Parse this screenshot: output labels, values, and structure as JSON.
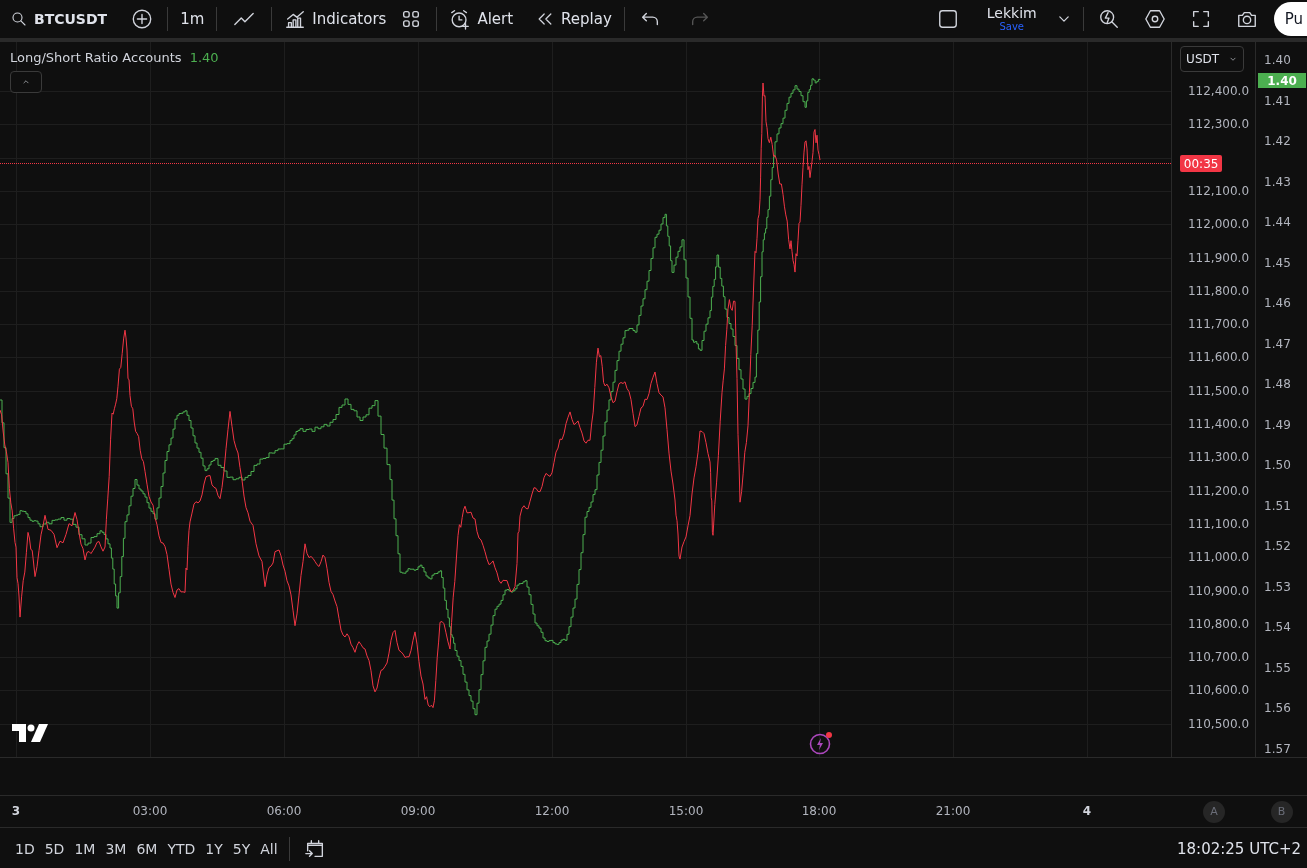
{
  "toolbar": {
    "symbol": "BTCUSDT",
    "interval": "1m",
    "indicators": "Indicators",
    "alert": "Alert",
    "replay": "Replay",
    "layout_name": "Lekkim",
    "save": "Save",
    "publish": "Pu"
  },
  "legend": {
    "title": "Long/Short Ratio Accounts",
    "value": "1.40"
  },
  "currency": "USDT",
  "price_axis": [
    "112,400.0",
    "112,300.0",
    "112,100.0",
    "112,000.0",
    "111,900.0",
    "111,800.0",
    "111,700.0",
    "111,600.0",
    "111,500.0",
    "111,400.0",
    "111,300.0",
    "111,200.0",
    "111,100.0",
    "111,000.0",
    "110,900.0",
    "110,800.0",
    "110,700.0",
    "110,600.0",
    "110,500.0"
  ],
  "ratio_axis": [
    "1.40",
    "1.41",
    "1.42",
    "1.43",
    "1.44",
    "1.45",
    "1.46",
    "1.47",
    "1.48",
    "1.49",
    "1.50",
    "1.51",
    "1.52",
    "1.53",
    "1.54",
    "1.55",
    "1.56",
    "1.57"
  ],
  "ratio_badge": "1.40",
  "countdown": "00:35",
  "time_axis": [
    {
      "label": "3",
      "kind": "day"
    },
    {
      "label": "03:00",
      "kind": "time"
    },
    {
      "label": "06:00",
      "kind": "time"
    },
    {
      "label": "09:00",
      "kind": "time"
    },
    {
      "label": "12:00",
      "kind": "time"
    },
    {
      "label": "15:00",
      "kind": "time"
    },
    {
      "label": "18:00",
      "kind": "time"
    },
    {
      "label": "21:00",
      "kind": "time"
    },
    {
      "label": "4",
      "kind": "day"
    }
  ],
  "scale_buttons": [
    "A",
    "B"
  ],
  "ranges": [
    "1D",
    "5D",
    "1M",
    "3M",
    "6M",
    "YTD",
    "1Y",
    "5Y",
    "All"
  ],
  "clock": "18:02:25 UTC+2"
}
